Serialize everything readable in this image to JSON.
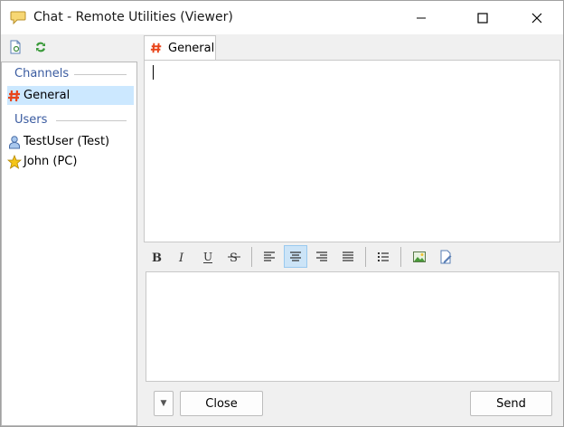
{
  "window": {
    "title": "Chat - Remote Utilities (Viewer)"
  },
  "left_toolbar": {
    "icons": [
      "document-icon",
      "refresh-icon"
    ]
  },
  "sidebar": {
    "channels_header": "Channels",
    "channels": [
      {
        "label": "General",
        "icon": "hash-icon",
        "selected": true
      }
    ],
    "users_header": "Users",
    "users": [
      {
        "label": "TestUser (Test)",
        "icon": "user-icon"
      },
      {
        "label": "John (PC)",
        "icon": "star-icon"
      }
    ]
  },
  "tabs": [
    {
      "label": "General",
      "icon": "hash-icon",
      "active": true
    }
  ],
  "messages": {
    "content": ""
  },
  "format_toolbar": {
    "buttons": [
      "bold",
      "italic",
      "underline",
      "strikethrough",
      "align-left",
      "align-center",
      "align-right",
      "justify",
      "bullet-list",
      "insert-image",
      "insert-file"
    ],
    "active": "align-center"
  },
  "input": {
    "value": ""
  },
  "bottom": {
    "dropdown_glyph": "▼",
    "close_label": "Close",
    "send_label": "Send"
  },
  "colors": {
    "selection": "#cce8ff",
    "group_header": "#3a5ba0",
    "hash": "#e8441a"
  }
}
